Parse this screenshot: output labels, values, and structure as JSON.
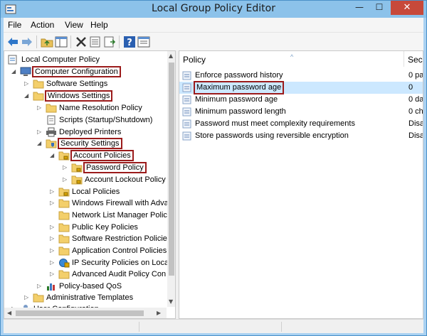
{
  "window": {
    "title": "Local Group Policy Editor",
    "minimize": "—",
    "maximize": "☐",
    "close": "✕"
  },
  "menu": [
    "File",
    "Action",
    "View",
    "Help"
  ],
  "tree": {
    "items": [
      {
        "label": "Local Computer Policy"
      },
      {
        "label": "Computer Configuration"
      },
      {
        "label": "Software Settings"
      },
      {
        "label": "Windows Settings"
      },
      {
        "label": "Name Resolution Policy"
      },
      {
        "label": "Scripts (Startup/Shutdown)"
      },
      {
        "label": "Deployed Printers"
      },
      {
        "label": "Security Settings"
      },
      {
        "label": "Account Policies"
      },
      {
        "label": "Password Policy"
      },
      {
        "label": "Account Lockout Policy"
      },
      {
        "label": "Local Policies"
      },
      {
        "label": "Windows Firewall with Adva"
      },
      {
        "label": "Network List Manager Polic"
      },
      {
        "label": "Public Key Policies"
      },
      {
        "label": "Software Restriction Policies"
      },
      {
        "label": "Application Control Policies"
      },
      {
        "label": "IP Security Policies on Local"
      },
      {
        "label": "Advanced Audit Policy Con"
      },
      {
        "label": "Policy-based QoS"
      },
      {
        "label": "Administrative Templates"
      },
      {
        "label": "User Configuration"
      }
    ]
  },
  "list": {
    "headers": {
      "policy": "Policy",
      "security": "Secu"
    },
    "rows": [
      {
        "name": "Enforce password history",
        "setting": "0 pa"
      },
      {
        "name": "Maximum password age",
        "setting": "0"
      },
      {
        "name": "Minimum password age",
        "setting": "0 da"
      },
      {
        "name": "Minimum password length",
        "setting": "0 ch"
      },
      {
        "name": "Password must meet complexity requirements",
        "setting": "Disa"
      },
      {
        "name": "Store passwords using reversible encryption",
        "setting": "Disa"
      }
    ]
  },
  "colors": {
    "highlight_border": "#9b1b1b",
    "selection": "#cce8ff",
    "titlebar": "#8cc2ea",
    "close_button": "#c7493a"
  },
  "icons": {
    "folder": "folder-icon",
    "policy_setting": "policy-setting-icon",
    "computer": "computer-icon",
    "user": "user-icon",
    "shield_folder": "security-folder-icon"
  }
}
